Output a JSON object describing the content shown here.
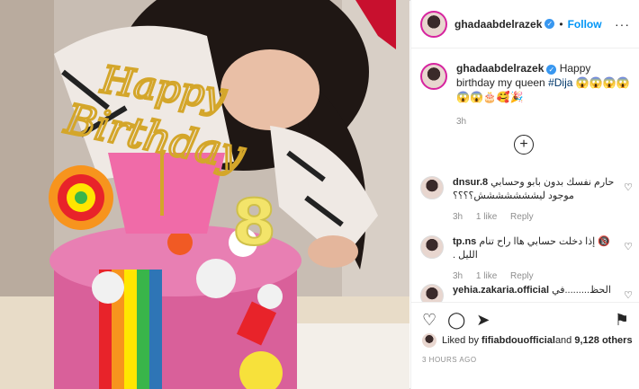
{
  "post": {
    "username": "ghadaabdelrazek",
    "verified_icon": "✓",
    "dot": "•",
    "follow_label": "Follow",
    "more_label": "···",
    "caption_user": "ghadaabdelrazek",
    "caption_text": " Happy birthday my queen ",
    "caption_hashtag": "#Dija",
    "caption_emojis": " 😱😱😱😱😱😱🎂🥰🎉",
    "caption_time": "3h",
    "load_more_icon": "+"
  },
  "comments": [
    {
      "user": "dnsur.8",
      "text": "حارم نفسك بدون بابو وحسابي موجود ليششششششش؟؟؟؟",
      "time": "3h",
      "likes": "1 like",
      "reply": "Reply"
    },
    {
      "user": "tp.ns",
      "text": "🔞 إذا دخلت حسابي هاا راح تنام الليل .",
      "time": "3h",
      "likes": "1 like",
      "reply": "Reply"
    },
    {
      "user": "yehia.zakaria.official",
      "text": "الحظ.........في"
    }
  ],
  "actions": {
    "like_icon": "♡",
    "comment_icon": "◯",
    "share_icon": "➤",
    "save_icon": "⚑"
  },
  "likes": {
    "prefix": "Liked by ",
    "user": "fifiabdouofficial",
    "suffix": " and ",
    "count": "9,128 others"
  },
  "posted_ago": "3 HOURS AGO",
  "photo": {
    "topper_text_1": "Happy",
    "topper_text_2": "Birthday",
    "candle_number": "8"
  }
}
